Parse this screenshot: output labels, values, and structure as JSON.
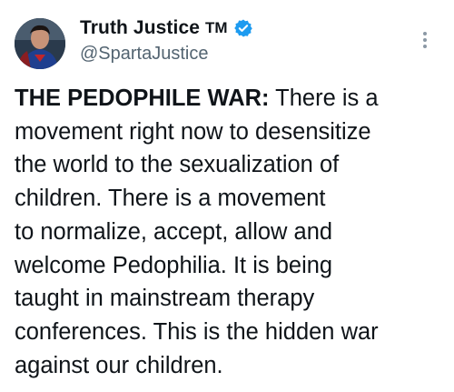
{
  "post": {
    "author": {
      "display_name": "Truth Justice",
      "trademark": "TM",
      "handle": "@SpartaJustice",
      "verified": true,
      "verified_color": "#1d9bf0"
    },
    "menu_icon": "more-vertical-icon",
    "text": {
      "lead": "THE PEDOPHILE WAR:",
      "lines": [
        " There is a",
        "movement right now to desensitize",
        "the world to the sexualization of",
        "children. There is a movement",
        "to normalize, accept, allow and",
        "welcome Pedophilia. It is being",
        "taught in mainstream therapy",
        "conferences. This is the hidden war",
        "against our children."
      ]
    }
  }
}
